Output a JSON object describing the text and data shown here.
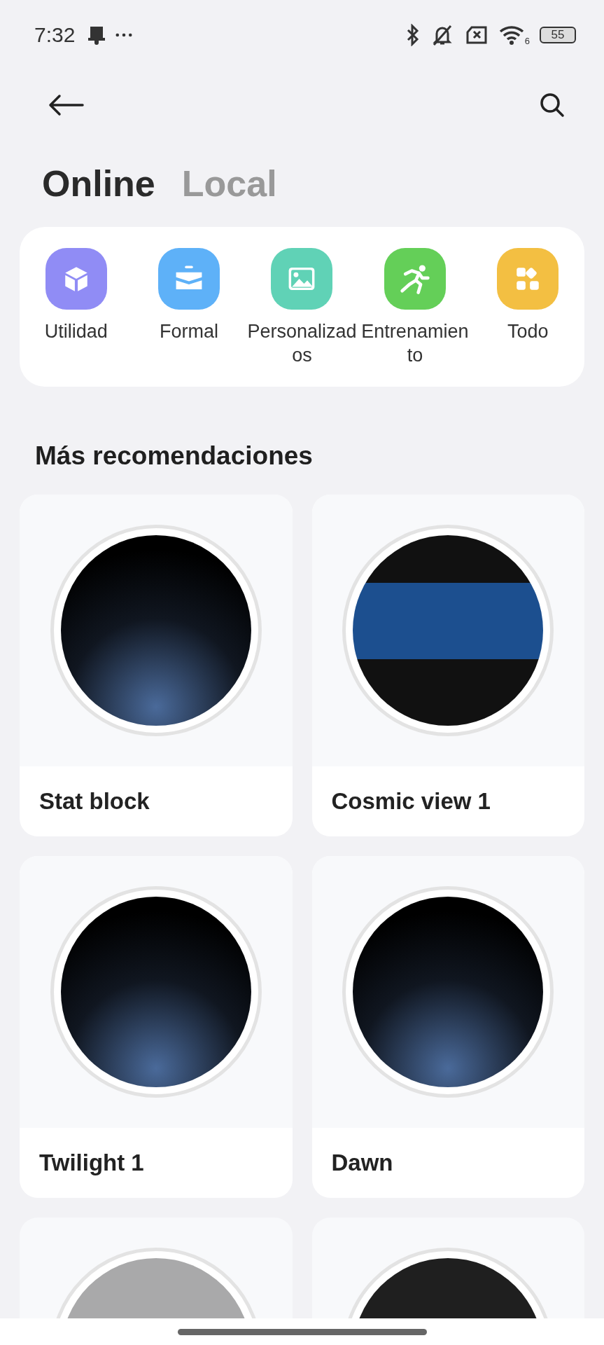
{
  "status_bar": {
    "time": "7:32",
    "network_type": "6",
    "battery": "55"
  },
  "tabs": [
    {
      "label": "Online",
      "selected": true
    },
    {
      "label": "Local",
      "selected": false
    }
  ],
  "categories": [
    {
      "label": "Utilidad",
      "kind": "cube",
      "color": "#908cf5"
    },
    {
      "label": "Formal",
      "kind": "briefcase",
      "color": "#5eb1f8"
    },
    {
      "label": "Personalizados",
      "kind": "image",
      "color": "#60d2b6"
    },
    {
      "label": "Entrenamiento",
      "kind": "runner",
      "color": "#64cf58"
    },
    {
      "label": "Todo",
      "kind": "grid",
      "color": "#f3bf42"
    }
  ],
  "section_title": "Más recomendaciones",
  "watch_faces": [
    {
      "name": "Stat block",
      "kind": "glow"
    },
    {
      "name": "Cosmic view 1",
      "kind": "band"
    },
    {
      "name": "Twilight 1",
      "kind": "glow"
    },
    {
      "name": "Dawn",
      "kind": "glow"
    },
    {
      "kind": "grey"
    },
    {
      "kind": "black"
    }
  ]
}
